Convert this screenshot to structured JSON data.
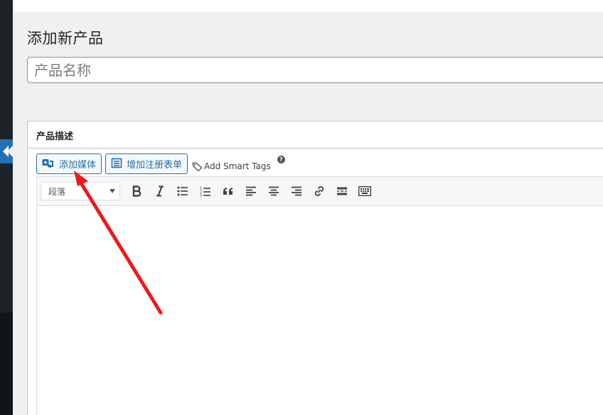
{
  "page": {
    "title": "添加新产品"
  },
  "product_name": {
    "value": "",
    "placeholder": "产品名称"
  },
  "description_box": {
    "heading": "产品描述",
    "buttons": {
      "add_media": "添加媒体",
      "add_form": "增加注册表单"
    },
    "smart_tags": "Add Smart Tags",
    "help": "?"
  },
  "toolbar": {
    "format_value": "段落",
    "tools": [
      "bold-icon",
      "italic-icon",
      "bulleted-list-icon",
      "numbered-list-icon",
      "blockquote-icon",
      "align-left-icon",
      "align-center-icon",
      "align-right-icon",
      "link-icon",
      "read-more-icon",
      "toolbar-toggle-icon"
    ]
  },
  "colors": {
    "accent": "#2271b1",
    "sidebar": "#1d2327",
    "annotation_arrow": "#f0171b"
  }
}
